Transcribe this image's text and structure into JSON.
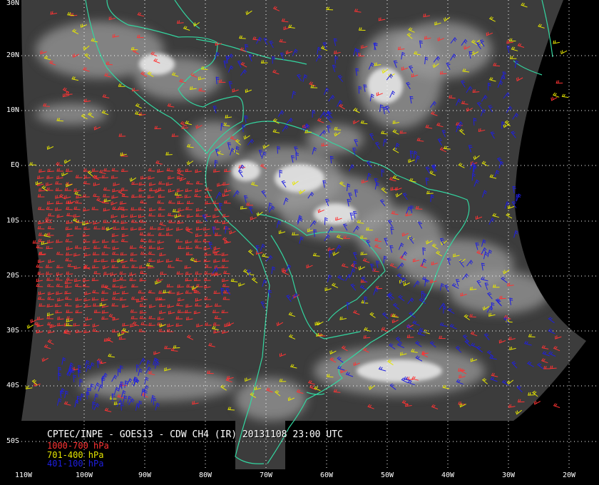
{
  "map": {
    "caption": "CPTEC/INPE - GOES13 - CDW CH4 (IR) 20131108 23:00 UTC",
    "colors": {
      "background": "#000000",
      "coast": "#33d6a0",
      "grid": "#ffffff",
      "cloud_dark": "#3c3c3c",
      "cloud_light": "#e6e6e6"
    },
    "legend": [
      {
        "label": "1000-700 hPa",
        "color": "#ff3333"
      },
      {
        "label": "701-400 hPa",
        "color": "#e6e600"
      },
      {
        "label": "401-100 hPa",
        "color": "#1f1fe0"
      }
    ],
    "latitude_labels": [
      "30N",
      "20N",
      "10N",
      "EQ",
      "10S",
      "20S",
      "30S",
      "40S",
      "50S"
    ],
    "longitude_labels": [
      "110W",
      "100W",
      "90W",
      "80W",
      "70W",
      "60W",
      "50W",
      "40W",
      "30W",
      "20W"
    ]
  }
}
